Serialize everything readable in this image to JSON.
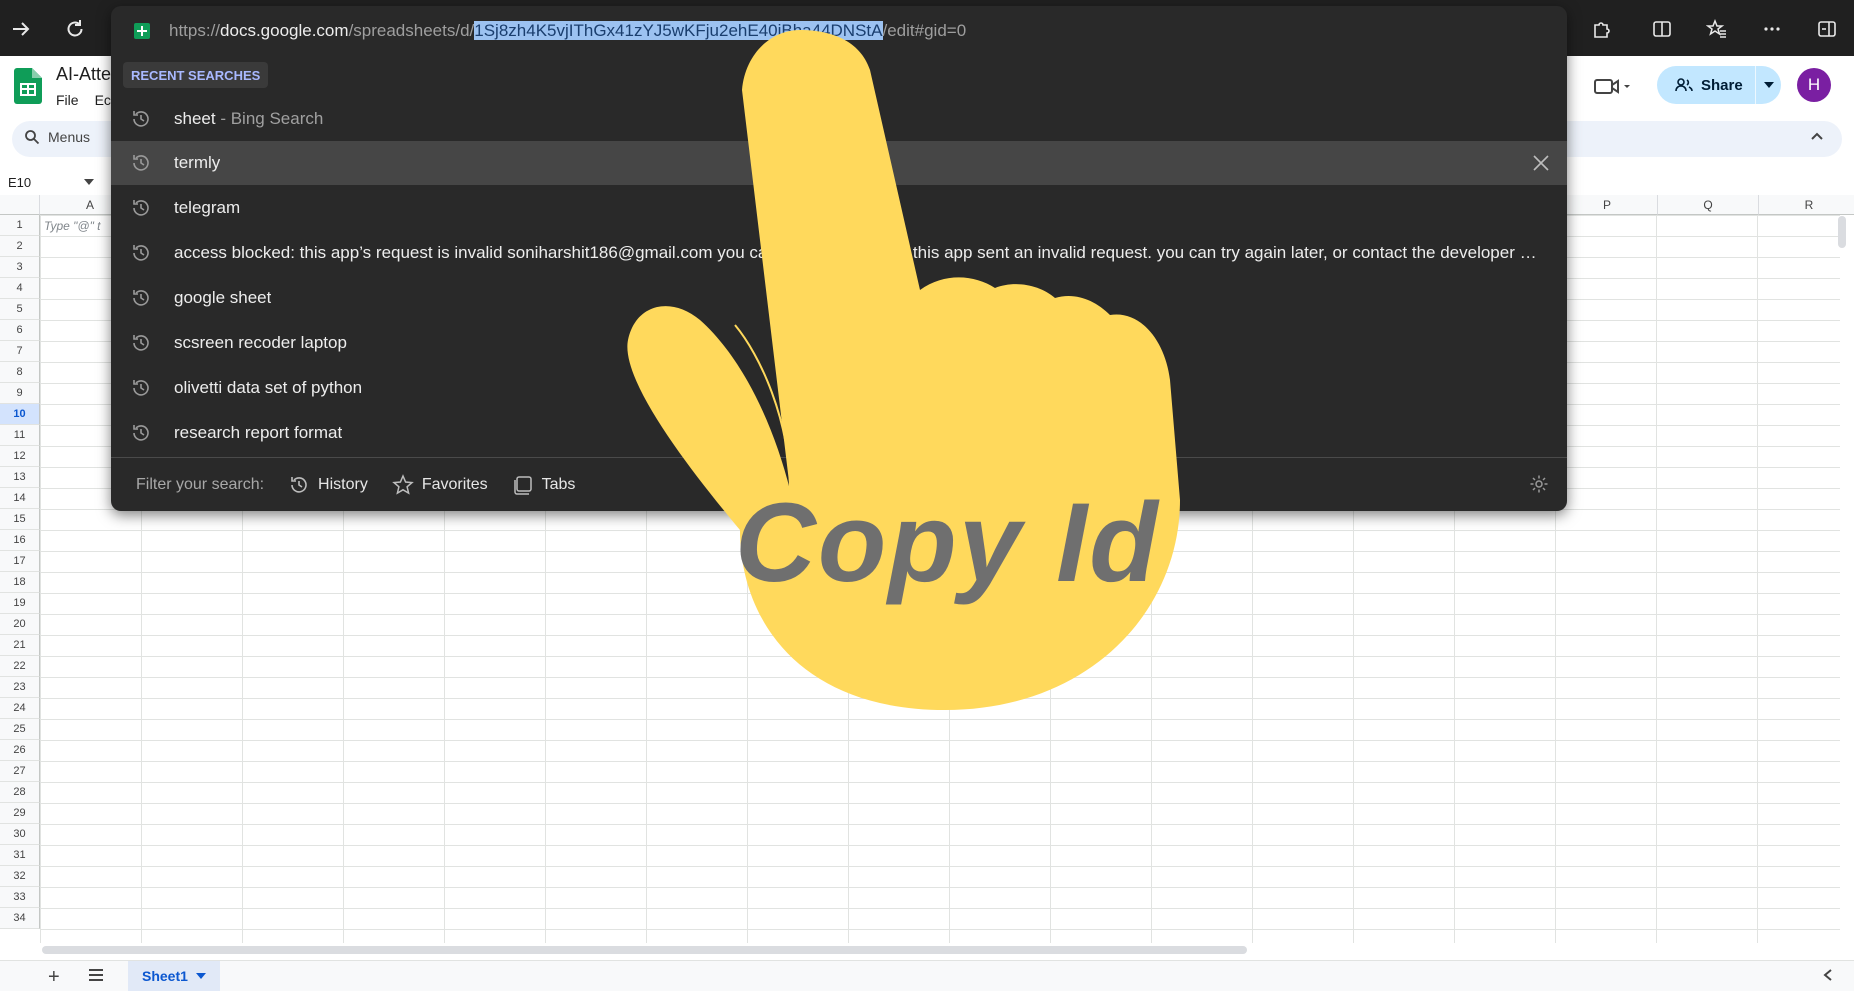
{
  "browser": {
    "url_prefix": "https://",
    "url_host": "docs.google.com",
    "url_path": "/spreadsheets/d/",
    "url_selected": "1Sj8zh4K5vjIThGx41zYJ5wKFju2ehE40iBha44DNStA",
    "url_suffix": "/edit#gid=0"
  },
  "sheets": {
    "title": "AI-Atte",
    "menu": [
      "File",
      "Ec"
    ],
    "menus_search": "Menus",
    "name_box": "E10",
    "cell_hint": "Type \"@\" t",
    "share_label": "Share",
    "avatar_letter": "H",
    "columns_visible": [
      "A",
      "P",
      "Q",
      "R"
    ],
    "rows": [
      "1",
      "2",
      "3",
      "4",
      "5",
      "6",
      "7",
      "8",
      "9",
      "10",
      "11",
      "12",
      "13",
      "14",
      "15",
      "16",
      "17",
      "18",
      "19",
      "20",
      "21",
      "22",
      "23",
      "24",
      "25",
      "26",
      "27",
      "28",
      "29",
      "30",
      "31",
      "32",
      "33",
      "34"
    ],
    "selected_row": "10",
    "sheet_tab": "Sheet1"
  },
  "dropdown": {
    "recent_header": "RECENT SEARCHES",
    "suggestions": [
      {
        "text": "sheet",
        "sub": " - Bing Search"
      },
      {
        "text": "termly",
        "sub": ""
      },
      {
        "text": "telegram",
        "sub": ""
      },
      {
        "text": "access blocked: this app’s request is invalid soniharshit186@gmail.com you can’t sign in because this app sent an invalid request. you can try again later, or contact the developer about this issue.",
        "sub": ""
      },
      {
        "text": "google sheet",
        "sub": ""
      },
      {
        "text": "scsreen recoder laptop",
        "sub": ""
      },
      {
        "text": "olivetti data set of python",
        "sub": ""
      },
      {
        "text": "research report format",
        "sub": ""
      }
    ],
    "highlighted_index": 1,
    "filter_label": "Filter your search:",
    "filters": [
      "History",
      "Favorites",
      "Tabs"
    ]
  },
  "overlay": {
    "caption": "Copy Id",
    "hand_color": "#ffd95c",
    "caption_color": "#6f6f6f"
  },
  "colors": {
    "accent_blue": "#0b57d0",
    "share_bg": "#c2e7ff",
    "sheets_green": "#0f9d58",
    "avatar": "#7a1fa2"
  }
}
